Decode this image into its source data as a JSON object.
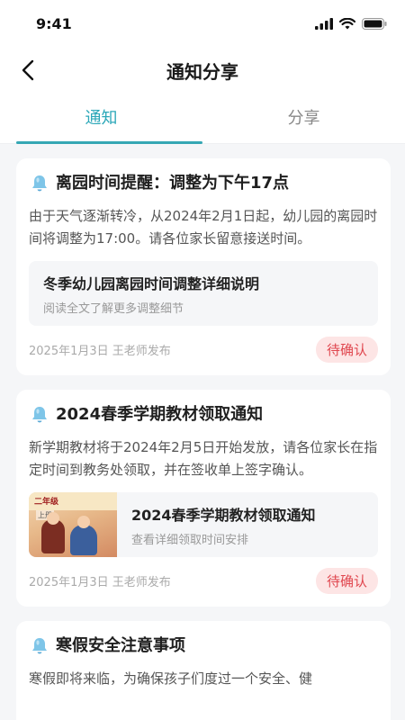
{
  "status_bar": {
    "time": "9:41"
  },
  "header": {
    "title": "通知分享"
  },
  "tabs": [
    {
      "label": "通知",
      "active": true
    },
    {
      "label": "分享",
      "active": false
    }
  ],
  "notices": [
    {
      "title": "离园时间提醒：调整为下午17点",
      "body": "由于天气逐渐转冷，从2024年2月1日起，幼儿园的离园时间将调整为17:00。请各位家长留意接送时间。",
      "attachment": {
        "title": "冬季幼儿园离园时间调整详细说明",
        "subtitle": "阅读全文了解更多调整细节",
        "has_thumb": false
      },
      "meta": "2025年1月3日 王老师发布",
      "badge": "待确认"
    },
    {
      "title": "2024春季学期教材领取通知",
      "body": "新学期教材将于2024年2月5日开始发放，请各位家长在指定时间到教务处领取，并在签收单上签字确认。",
      "attachment": {
        "title": "2024春季学期教材领取通知",
        "subtitle": "查看详细领取时间安排",
        "has_thumb": true,
        "thumb_grade": "二年级",
        "thumb_volume": "上册"
      },
      "meta": "2025年1月3日 王老师发布",
      "badge": "待确认"
    },
    {
      "title": "寒假安全注意事项",
      "body": "寒假即将来临，为确保孩子们度过一个安全、健",
      "meta": "",
      "badge": ""
    }
  ],
  "colors": {
    "accent": "#2ba7b8",
    "badge_bg": "#fde5e5",
    "badge_text": "#e0474f"
  },
  "icons": {
    "back": "chevron-left-icon",
    "notice": "bell-icon"
  }
}
